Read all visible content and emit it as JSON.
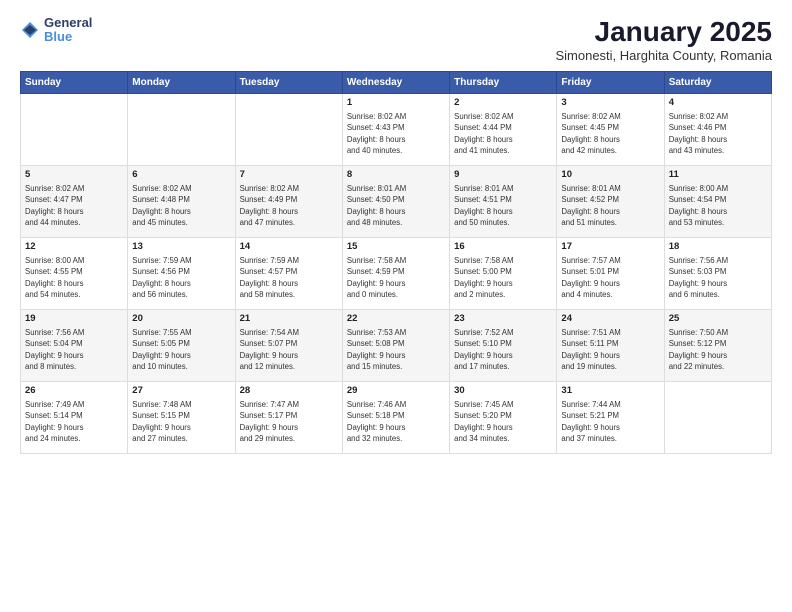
{
  "logo": {
    "general": "General",
    "blue": "Blue"
  },
  "title": "January 2025",
  "subtitle": "Simonesti, Harghita County, Romania",
  "days_header": [
    "Sunday",
    "Monday",
    "Tuesday",
    "Wednesday",
    "Thursday",
    "Friday",
    "Saturday"
  ],
  "weeks": [
    [
      {
        "num": "",
        "info": ""
      },
      {
        "num": "",
        "info": ""
      },
      {
        "num": "",
        "info": ""
      },
      {
        "num": "1",
        "info": "Sunrise: 8:02 AM\nSunset: 4:43 PM\nDaylight: 8 hours\nand 40 minutes."
      },
      {
        "num": "2",
        "info": "Sunrise: 8:02 AM\nSunset: 4:44 PM\nDaylight: 8 hours\nand 41 minutes."
      },
      {
        "num": "3",
        "info": "Sunrise: 8:02 AM\nSunset: 4:45 PM\nDaylight: 8 hours\nand 42 minutes."
      },
      {
        "num": "4",
        "info": "Sunrise: 8:02 AM\nSunset: 4:46 PM\nDaylight: 8 hours\nand 43 minutes."
      }
    ],
    [
      {
        "num": "5",
        "info": "Sunrise: 8:02 AM\nSunset: 4:47 PM\nDaylight: 8 hours\nand 44 minutes."
      },
      {
        "num": "6",
        "info": "Sunrise: 8:02 AM\nSunset: 4:48 PM\nDaylight: 8 hours\nand 45 minutes."
      },
      {
        "num": "7",
        "info": "Sunrise: 8:02 AM\nSunset: 4:49 PM\nDaylight: 8 hours\nand 47 minutes."
      },
      {
        "num": "8",
        "info": "Sunrise: 8:01 AM\nSunset: 4:50 PM\nDaylight: 8 hours\nand 48 minutes."
      },
      {
        "num": "9",
        "info": "Sunrise: 8:01 AM\nSunset: 4:51 PM\nDaylight: 8 hours\nand 50 minutes."
      },
      {
        "num": "10",
        "info": "Sunrise: 8:01 AM\nSunset: 4:52 PM\nDaylight: 8 hours\nand 51 minutes."
      },
      {
        "num": "11",
        "info": "Sunrise: 8:00 AM\nSunset: 4:54 PM\nDaylight: 8 hours\nand 53 minutes."
      }
    ],
    [
      {
        "num": "12",
        "info": "Sunrise: 8:00 AM\nSunset: 4:55 PM\nDaylight: 8 hours\nand 54 minutes."
      },
      {
        "num": "13",
        "info": "Sunrise: 7:59 AM\nSunset: 4:56 PM\nDaylight: 8 hours\nand 56 minutes."
      },
      {
        "num": "14",
        "info": "Sunrise: 7:59 AM\nSunset: 4:57 PM\nDaylight: 8 hours\nand 58 minutes."
      },
      {
        "num": "15",
        "info": "Sunrise: 7:58 AM\nSunset: 4:59 PM\nDaylight: 9 hours\nand 0 minutes."
      },
      {
        "num": "16",
        "info": "Sunrise: 7:58 AM\nSunset: 5:00 PM\nDaylight: 9 hours\nand 2 minutes."
      },
      {
        "num": "17",
        "info": "Sunrise: 7:57 AM\nSunset: 5:01 PM\nDaylight: 9 hours\nand 4 minutes."
      },
      {
        "num": "18",
        "info": "Sunrise: 7:56 AM\nSunset: 5:03 PM\nDaylight: 9 hours\nand 6 minutes."
      }
    ],
    [
      {
        "num": "19",
        "info": "Sunrise: 7:56 AM\nSunset: 5:04 PM\nDaylight: 9 hours\nand 8 minutes."
      },
      {
        "num": "20",
        "info": "Sunrise: 7:55 AM\nSunset: 5:05 PM\nDaylight: 9 hours\nand 10 minutes."
      },
      {
        "num": "21",
        "info": "Sunrise: 7:54 AM\nSunset: 5:07 PM\nDaylight: 9 hours\nand 12 minutes."
      },
      {
        "num": "22",
        "info": "Sunrise: 7:53 AM\nSunset: 5:08 PM\nDaylight: 9 hours\nand 15 minutes."
      },
      {
        "num": "23",
        "info": "Sunrise: 7:52 AM\nSunset: 5:10 PM\nDaylight: 9 hours\nand 17 minutes."
      },
      {
        "num": "24",
        "info": "Sunrise: 7:51 AM\nSunset: 5:11 PM\nDaylight: 9 hours\nand 19 minutes."
      },
      {
        "num": "25",
        "info": "Sunrise: 7:50 AM\nSunset: 5:12 PM\nDaylight: 9 hours\nand 22 minutes."
      }
    ],
    [
      {
        "num": "26",
        "info": "Sunrise: 7:49 AM\nSunset: 5:14 PM\nDaylight: 9 hours\nand 24 minutes."
      },
      {
        "num": "27",
        "info": "Sunrise: 7:48 AM\nSunset: 5:15 PM\nDaylight: 9 hours\nand 27 minutes."
      },
      {
        "num": "28",
        "info": "Sunrise: 7:47 AM\nSunset: 5:17 PM\nDaylight: 9 hours\nand 29 minutes."
      },
      {
        "num": "29",
        "info": "Sunrise: 7:46 AM\nSunset: 5:18 PM\nDaylight: 9 hours\nand 32 minutes."
      },
      {
        "num": "30",
        "info": "Sunrise: 7:45 AM\nSunset: 5:20 PM\nDaylight: 9 hours\nand 34 minutes."
      },
      {
        "num": "31",
        "info": "Sunrise: 7:44 AM\nSunset: 5:21 PM\nDaylight: 9 hours\nand 37 minutes."
      },
      {
        "num": "",
        "info": ""
      }
    ]
  ]
}
